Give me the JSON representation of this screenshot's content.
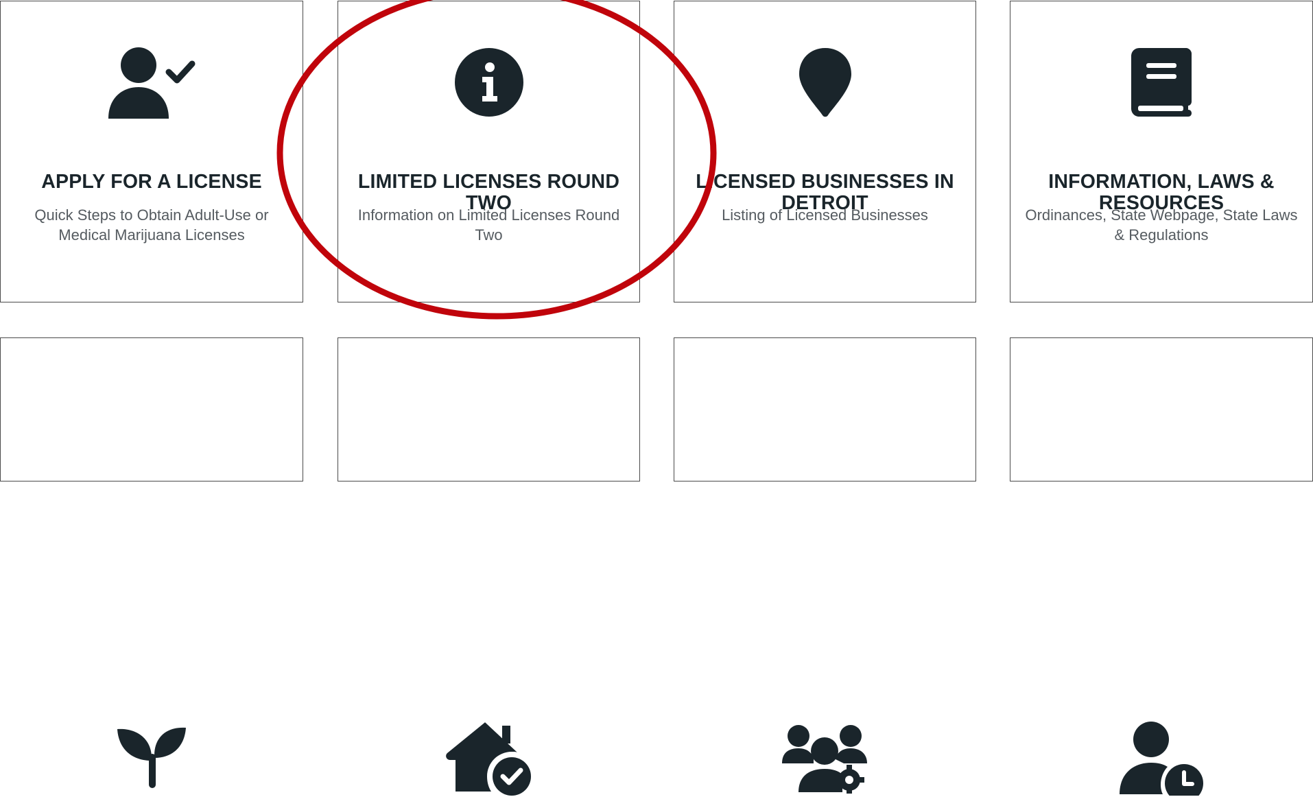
{
  "colors": {
    "icon": "#1a252b",
    "annotation": "#c0040b",
    "description": "#555b60"
  },
  "cards": [
    {
      "icon": "user-check-icon",
      "title": "APPLY FOR A LICENSE",
      "description": "Quick Steps to Obtain Adult-Use or Medical Marijuana Licenses"
    },
    {
      "icon": "info-circle-icon",
      "title": "LIMITED LICENSES ROUND TWO",
      "description": "Information on Limited Licenses Round Two"
    },
    {
      "icon": "map-pin-icon",
      "title": "LICENSED BUSINESSES IN DETROIT",
      "description": "Listing of  Licensed Businesses"
    },
    {
      "icon": "book-icon",
      "title": "INFORMATION, LAWS & RESOURCES",
      "description": "Ordinances, State Webpage, State Laws & Regulations"
    },
    {
      "icon": "seedling-icon"
    },
    {
      "icon": "house-check-icon"
    },
    {
      "icon": "users-gear-icon"
    },
    {
      "icon": "user-clock-icon"
    }
  ]
}
